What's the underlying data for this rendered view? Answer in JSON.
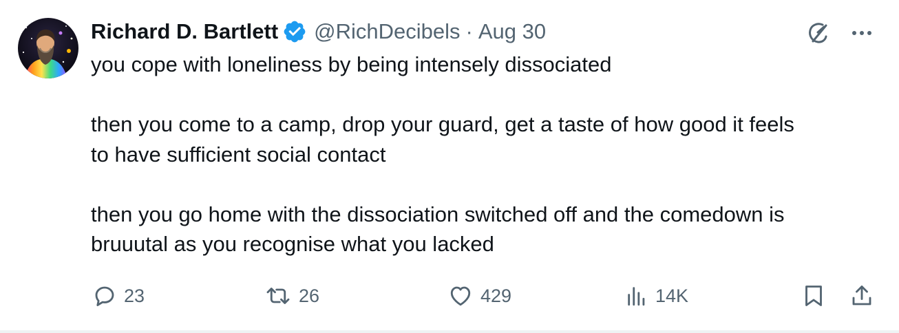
{
  "author": {
    "name": "Richard D. Bartlett",
    "handle": "@RichDecibels",
    "separator": "·",
    "date": "Aug 30",
    "verified": true,
    "badge_color": "#1d9bf0"
  },
  "icons": {
    "grok": "grok-icon",
    "more": "more-icon",
    "reply": "reply-icon",
    "retweet": "retweet-icon",
    "like": "like-icon",
    "views": "views-icon",
    "bookmark": "bookmark-icon",
    "share": "share-icon"
  },
  "tweet": {
    "paragraphs": [
      {
        "lines": [
          "you cope with loneliness by being intensely dissociated"
        ]
      },
      {
        "lines": [
          "then you come to a camp, drop your guard, get a taste of how good it feels",
          "to have sufficient social contact"
        ]
      },
      {
        "lines": [
          "then you go home with the dissociation switched off and the comedown is",
          "bruuutal as you recognise what you lacked"
        ]
      }
    ]
  },
  "stats": {
    "replies": "23",
    "retweets": "26",
    "likes": "429",
    "views": "14K"
  },
  "colors": {
    "text": "#0f1419",
    "secondary": "#536471",
    "accent": "#1d9bf0"
  }
}
